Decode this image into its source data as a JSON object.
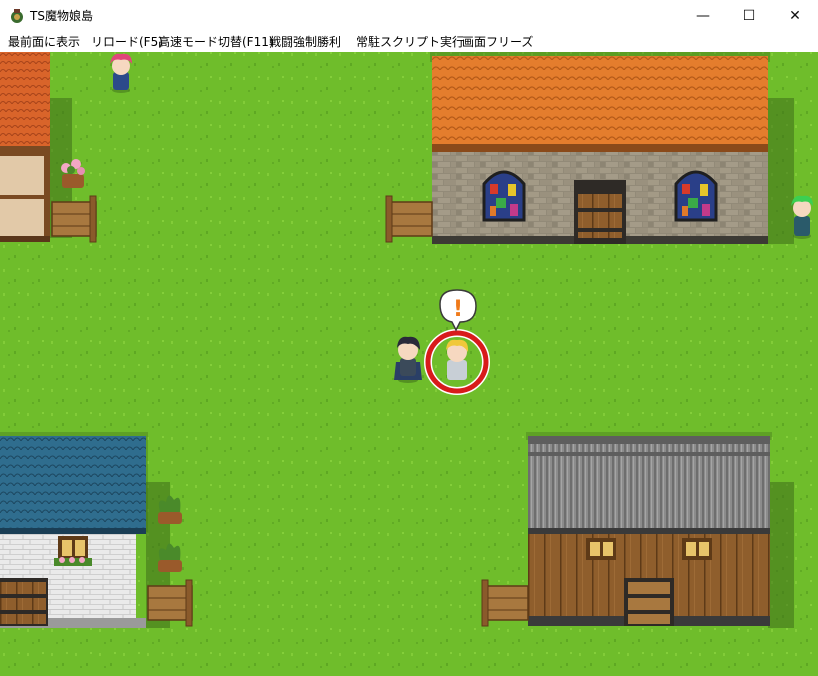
{
  "window": {
    "title": "TS魔物娘島",
    "controls": {
      "minimize": "—",
      "maximize": "☐",
      "close": "✕"
    }
  },
  "menu": [
    "最前面に表示",
    "リロード(F5)",
    "高速モード切替(F11)",
    "戦闘強制勝利",
    "常駐スクリプト実行",
    "画面フリーズ"
  ],
  "game": {
    "balloon": "!",
    "colors": {
      "grass": "#6fbd2b",
      "orange_roof": "#e07a2a",
      "blue_roof": "#2d6a8c",
      "wood": "#8a5a2b",
      "stone": "#8c8474",
      "highlight_ring": "#d81b1b"
    }
  }
}
